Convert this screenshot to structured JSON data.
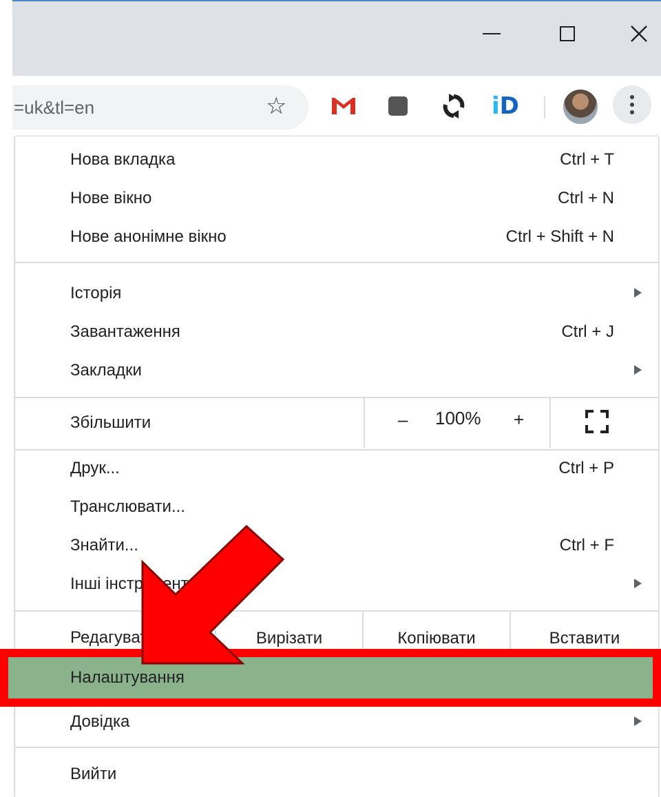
{
  "window": {
    "minimize_label": "—",
    "maximize_label": "□",
    "close_label": "✕"
  },
  "toolbar": {
    "url_text": "=uk&tl=en",
    "bookmark_icon": "star-icon",
    "extensions": [
      "gmail-icon",
      "square-extension-icon",
      "sync-extension-icon",
      "id-extension-icon"
    ],
    "id_ext_i": "i",
    "id_ext_d": "D"
  },
  "menu": {
    "group1": [
      {
        "label": "Нова вкладка",
        "shortcut": "Ctrl + T"
      },
      {
        "label": "Нове вікно",
        "shortcut": "Ctrl + N"
      },
      {
        "label": "Нове анонімне вікно",
        "shortcut": "Ctrl + Shift + N"
      }
    ],
    "group2": [
      {
        "label": "Історія",
        "shortcut": ""
      },
      {
        "label": "Завантаження",
        "shortcut": "Ctrl + J"
      },
      {
        "label": "Закладки",
        "shortcut": ""
      }
    ],
    "zoom": {
      "label": "Збільшити",
      "minus": "–",
      "value": "100%",
      "plus": "+"
    },
    "group3": [
      {
        "label": "Друк...",
        "shortcut": "Ctrl + P"
      },
      {
        "label": "Транслювати...",
        "shortcut": ""
      },
      {
        "label": "Знайти...",
        "shortcut": "Ctrl + F"
      },
      {
        "label": "Інші інструменти",
        "shortcut": ""
      }
    ],
    "edit": {
      "label": "Редагувати",
      "cut": "Вирізати",
      "copy": "Копіювати",
      "paste": "Вставити"
    },
    "settings": {
      "label": "Налаштування"
    },
    "help": {
      "label": "Довідка"
    },
    "exit": {
      "label": "Вийти"
    }
  },
  "colors": {
    "highlight_border": "#ff0000",
    "highlight_fill": "#8bb38b",
    "annotation_arrow": "#ff0000"
  }
}
